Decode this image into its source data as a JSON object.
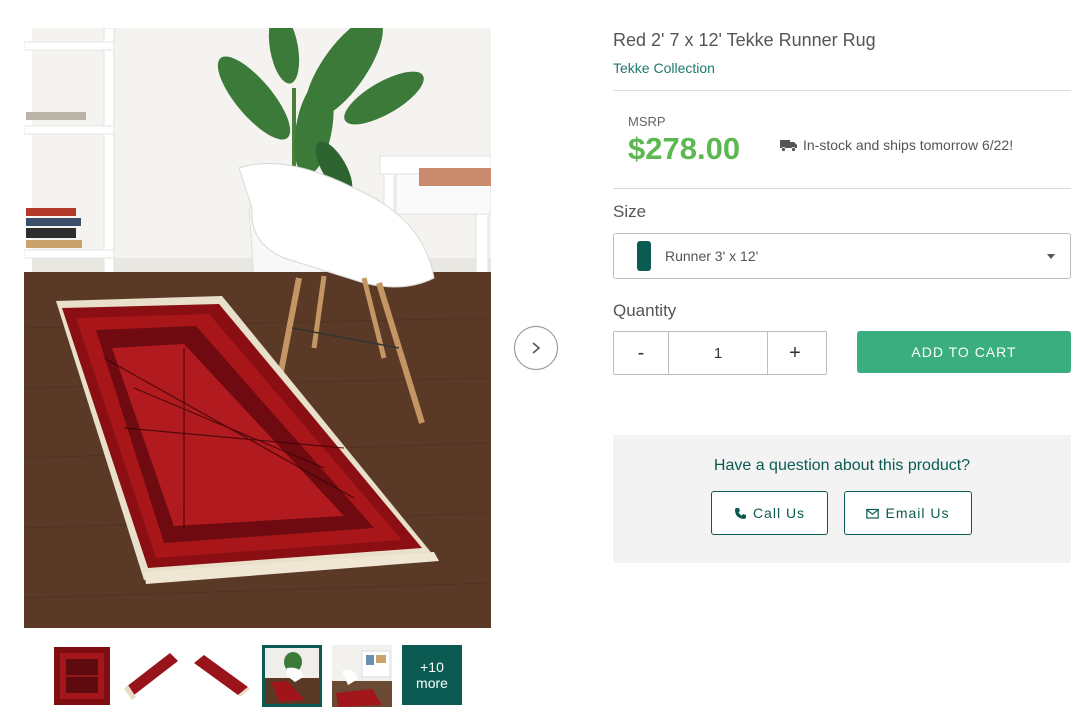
{
  "product": {
    "title": "Red 2' 7 x 12' Tekke Runner Rug",
    "collection": "Tekke Collection",
    "msrp_label": "MSRP",
    "price": "$278.00",
    "stock_text": "In-stock and ships tomorrow 6/22!"
  },
  "size": {
    "label": "Size",
    "selected": "Runner 3' x 12'",
    "swatch_color": "#0c5b52"
  },
  "quantity": {
    "label": "Quantity",
    "value": "1",
    "minus": "-",
    "plus": "+"
  },
  "cart": {
    "add_label": "ADD TO CART"
  },
  "question": {
    "text": "Have a question about this product?",
    "call_label": "Call Us",
    "email_label": "Email Us"
  },
  "thumbnails": {
    "more_count": "+10",
    "more_label": "more"
  },
  "colors": {
    "brand": "#0c5b52",
    "price": "#5cb850",
    "cart": "#3aae7f",
    "link": "#1d7a6e"
  },
  "icons": [
    "chevron-right-icon",
    "truck-icon",
    "phone-icon",
    "envelope-icon",
    "caret-down-icon"
  ]
}
